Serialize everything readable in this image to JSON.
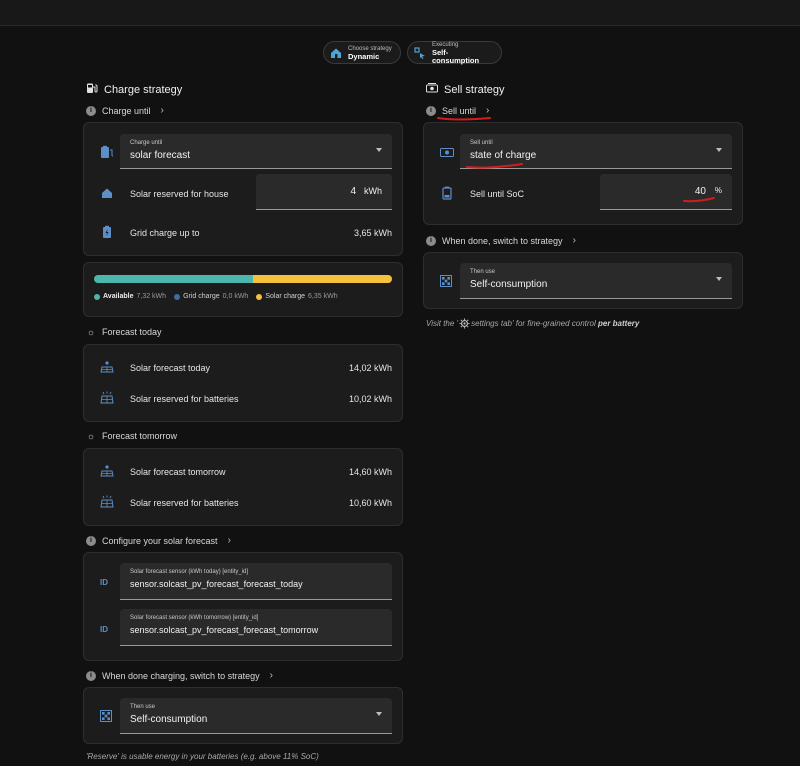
{
  "header": {
    "chips": [
      {
        "small": "Choose strategy",
        "main": "Dynamic",
        "icon": "house-strategy-icon"
      },
      {
        "small": "Executing",
        "main": "Self-consumption",
        "icon": "execute-icon"
      }
    ]
  },
  "charge": {
    "title": "Charge strategy",
    "charge_until": {
      "heading": "Charge until",
      "select_label": "Charge until",
      "select_value": "solar forecast",
      "reserved_label": "Solar reserved for house",
      "reserved_value": "4",
      "reserved_unit": "kWh",
      "grid_label": "Grid charge up to",
      "grid_value": "3,65 kWh"
    },
    "energy_bar": {
      "available_label": "Available",
      "available_value": "7,32 kWh",
      "available_fraction": 0.535,
      "grid_label": "Grid charge",
      "grid_value": "0,0 kWh",
      "grid_fraction": 0,
      "solar_label": "Solar charge",
      "solar_value": "6,35 kWh",
      "solar_fraction": 0.465,
      "colors": {
        "available": "#4db6ac",
        "grid": "#3f6d9c",
        "solar": "#f5c13d"
      }
    },
    "forecast_today": {
      "heading": "Forecast today",
      "rows": [
        {
          "label": "Solar forecast today",
          "value": "14,02 kWh"
        },
        {
          "label": "Solar reserved for batteries",
          "value": "10,02 kWh"
        }
      ]
    },
    "forecast_tomorrow": {
      "heading": "Forecast tomorrow",
      "rows": [
        {
          "label": "Solar forecast tomorrow",
          "value": "14,60 kWh"
        },
        {
          "label": "Solar reserved for batteries",
          "value": "10,60 kWh"
        }
      ]
    },
    "configure": {
      "heading": "Configure your solar forecast",
      "fields": [
        {
          "label": "Solar forecast sensor (kWh today) [entity_id]",
          "value": "sensor.solcast_pv_forecast_forecast_today"
        },
        {
          "label": "Solar forecast sensor (kWh tomorrow) [entity_id]",
          "value": "sensor.solcast_pv_forecast_forecast_tomorrow"
        }
      ]
    },
    "when_done": {
      "heading": "When done charging, switch to strategy",
      "select_label": "Then use",
      "select_value": "Self-consumption"
    },
    "footnote": "'Reserve' is usable energy in your batteries (e.g. above 11% SoC)"
  },
  "sell": {
    "title": "Sell strategy",
    "sell_until": {
      "heading": "Sell until",
      "select_label": "Sell until",
      "select_value": "state of charge",
      "soc_label": "Sell until SoC",
      "soc_value": "40",
      "soc_unit": "%"
    },
    "when_done": {
      "heading": "When done, switch to strategy",
      "select_label": "Then use",
      "select_value": "Self-consumption"
    },
    "footnote_pre": "Visit the '",
    "footnote_mid": "settings tab' for fine-grained control ",
    "footnote_bold": "per battery"
  },
  "annotation_color": "#d21d1d"
}
